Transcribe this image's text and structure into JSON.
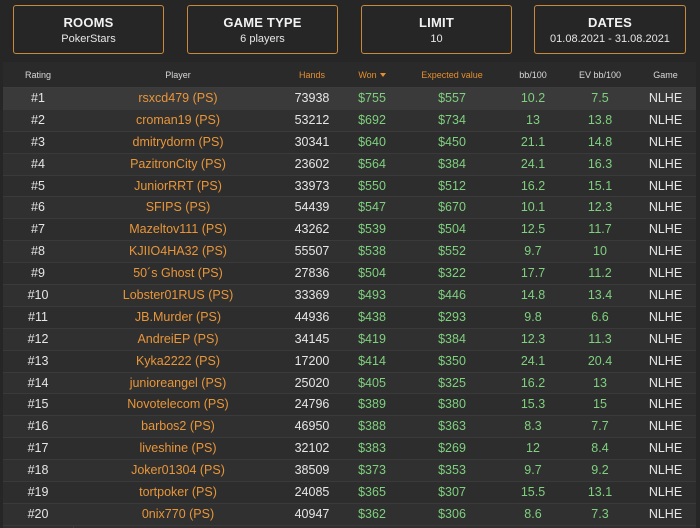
{
  "filters": {
    "rooms": {
      "title": "ROOMS",
      "value": "PokerStars"
    },
    "game_type": {
      "title": "GAME TYPE",
      "value": "6 players"
    },
    "limit": {
      "title": "LIMIT",
      "value": "10"
    },
    "dates": {
      "title": "DATES",
      "value": "01.08.2021 - 31.08.2021"
    }
  },
  "columns": {
    "rating": "Rating",
    "player": "Player",
    "hands": "Hands",
    "won": "Won",
    "expected": "Expected value",
    "bb100": "bb/100",
    "evbb100": "EV bb/100",
    "game": "Game"
  },
  "rows": [
    {
      "rank": "#1",
      "player": "rsxcd479 (PS)",
      "hands": "73938",
      "won": "$755",
      "expected": "$557",
      "bb": "10.2",
      "evbb": "7.5",
      "game": "NLHE"
    },
    {
      "rank": "#2",
      "player": "croman19 (PS)",
      "hands": "53212",
      "won": "$692",
      "expected": "$734",
      "bb": "13",
      "evbb": "13.8",
      "game": "NLHE"
    },
    {
      "rank": "#3",
      "player": "dmitrydorm (PS)",
      "hands": "30341",
      "won": "$640",
      "expected": "$450",
      "bb": "21.1",
      "evbb": "14.8",
      "game": "NLHE"
    },
    {
      "rank": "#4",
      "player": "PazitronCity (PS)",
      "hands": "23602",
      "won": "$564",
      "expected": "$384",
      "bb": "24.1",
      "evbb": "16.3",
      "game": "NLHE"
    },
    {
      "rank": "#5",
      "player": "JuniorRRT (PS)",
      "hands": "33973",
      "won": "$550",
      "expected": "$512",
      "bb": "16.2",
      "evbb": "15.1",
      "game": "NLHE"
    },
    {
      "rank": "#6",
      "player": "SFIPS (PS)",
      "hands": "54439",
      "won": "$547",
      "expected": "$670",
      "bb": "10.1",
      "evbb": "12.3",
      "game": "NLHE"
    },
    {
      "rank": "#7",
      "player": "Mazeltov111 (PS)",
      "hands": "43262",
      "won": "$539",
      "expected": "$504",
      "bb": "12.5",
      "evbb": "11.7",
      "game": "NLHE"
    },
    {
      "rank": "#8",
      "player": "KJIIO4HA32 (PS)",
      "hands": "55507",
      "won": "$538",
      "expected": "$552",
      "bb": "9.7",
      "evbb": "10",
      "game": "NLHE"
    },
    {
      "rank": "#9",
      "player": "50´s Ghost (PS)",
      "hands": "27836",
      "won": "$504",
      "expected": "$322",
      "bb": "17.7",
      "evbb": "11.2",
      "game": "NLHE"
    },
    {
      "rank": "#10",
      "player": "Lobster01RUS (PS)",
      "hands": "33369",
      "won": "$493",
      "expected": "$446",
      "bb": "14.8",
      "evbb": "13.4",
      "game": "NLHE"
    },
    {
      "rank": "#11",
      "player": "JB.Murder (PS)",
      "hands": "44936",
      "won": "$438",
      "expected": "$293",
      "bb": "9.8",
      "evbb": "6.6",
      "game": "NLHE"
    },
    {
      "rank": "#12",
      "player": "AndreiEP (PS)",
      "hands": "34145",
      "won": "$419",
      "expected": "$384",
      "bb": "12.3",
      "evbb": "11.3",
      "game": "NLHE"
    },
    {
      "rank": "#13",
      "player": "Kyka2222 (PS)",
      "hands": "17200",
      "won": "$414",
      "expected": "$350",
      "bb": "24.1",
      "evbb": "20.4",
      "game": "NLHE"
    },
    {
      "rank": "#14",
      "player": "junioreangel (PS)",
      "hands": "25020",
      "won": "$405",
      "expected": "$325",
      "bb": "16.2",
      "evbb": "13",
      "game": "NLHE"
    },
    {
      "rank": "#15",
      "player": "Novotelecom (PS)",
      "hands": "24796",
      "won": "$389",
      "expected": "$380",
      "bb": "15.3",
      "evbb": "15",
      "game": "NLHE"
    },
    {
      "rank": "#16",
      "player": "barbos2 (PS)",
      "hands": "46950",
      "won": "$388",
      "expected": "$363",
      "bb": "8.3",
      "evbb": "7.7",
      "game": "NLHE"
    },
    {
      "rank": "#17",
      "player": "liveshine (PS)",
      "hands": "32102",
      "won": "$383",
      "expected": "$269",
      "bb": "12",
      "evbb": "8.4",
      "game": "NLHE"
    },
    {
      "rank": "#18",
      "player": "Joker01304 (PS)",
      "hands": "38509",
      "won": "$373",
      "expected": "$353",
      "bb": "9.7",
      "evbb": "9.2",
      "game": "NLHE"
    },
    {
      "rank": "#19",
      "player": "tortpoker (PS)",
      "hands": "24085",
      "won": "$365",
      "expected": "$307",
      "bb": "15.5",
      "evbb": "13.1",
      "game": "NLHE"
    },
    {
      "rank": "#20",
      "player": "0nix770 (PS)",
      "hands": "40947",
      "won": "$362",
      "expected": "$306",
      "bb": "8.6",
      "evbb": "7.3",
      "game": "NLHE"
    }
  ]
}
